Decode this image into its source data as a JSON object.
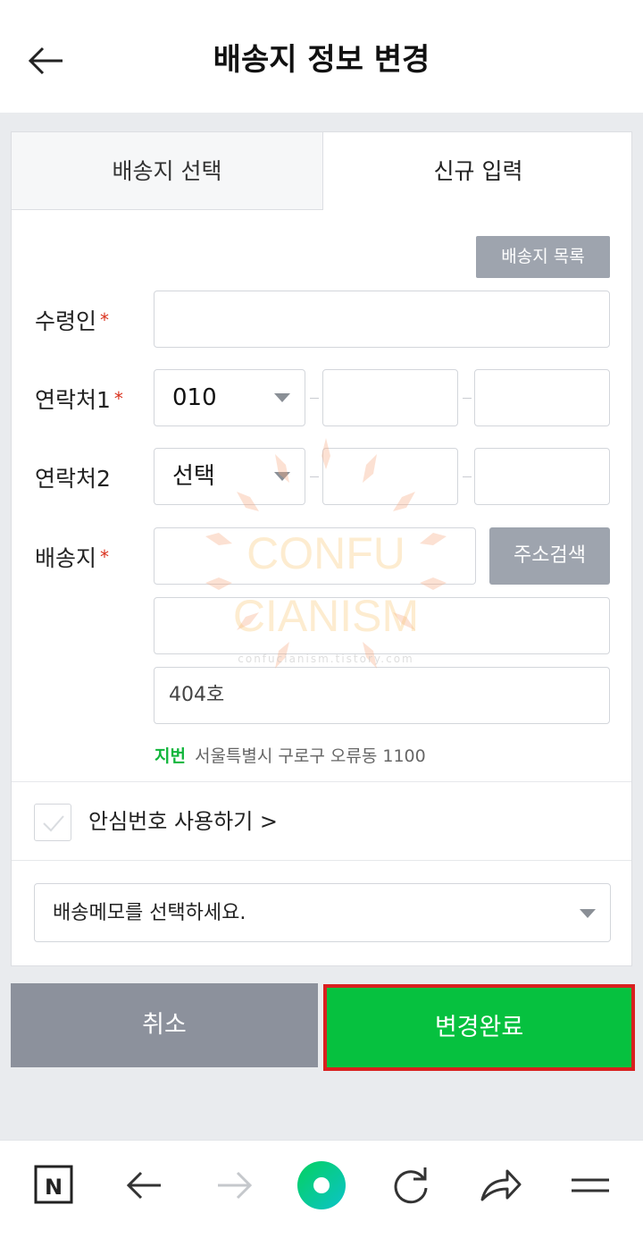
{
  "header": {
    "title": "배송지 정보 변경"
  },
  "tabs": {
    "select_label": "배송지 선택",
    "new_label": "신규 입력"
  },
  "form": {
    "list_button": "배송지 목록",
    "recipient_label": "수령인",
    "phone1_label": "연락처1",
    "phone1_prefix": "010",
    "phone2_label": "연락처2",
    "phone2_prefix": "선택",
    "address_label": "배송지",
    "required_mark": "*",
    "address_search_button": "주소검색",
    "detail_value": "404호",
    "jibun_tag": "지번",
    "jibun_value": "서울특별시 구로구 오류동 1100",
    "safe_number_label": "안심번호 사용하기 >",
    "memo_placeholder": "배송메모를 선택하세요."
  },
  "actions": {
    "cancel": "취소",
    "confirm": "변경완료"
  },
  "watermark": {
    "line1": "CONFU",
    "line2": "CIANISM",
    "url": "confucianism.tistory.com"
  },
  "navbar": {
    "home_icon": "N"
  },
  "colors": {
    "confirm_green": "#06c13f",
    "confirm_border": "#d9201f",
    "required_red": "#d9321e",
    "gray_button": "#9ea4ae"
  }
}
